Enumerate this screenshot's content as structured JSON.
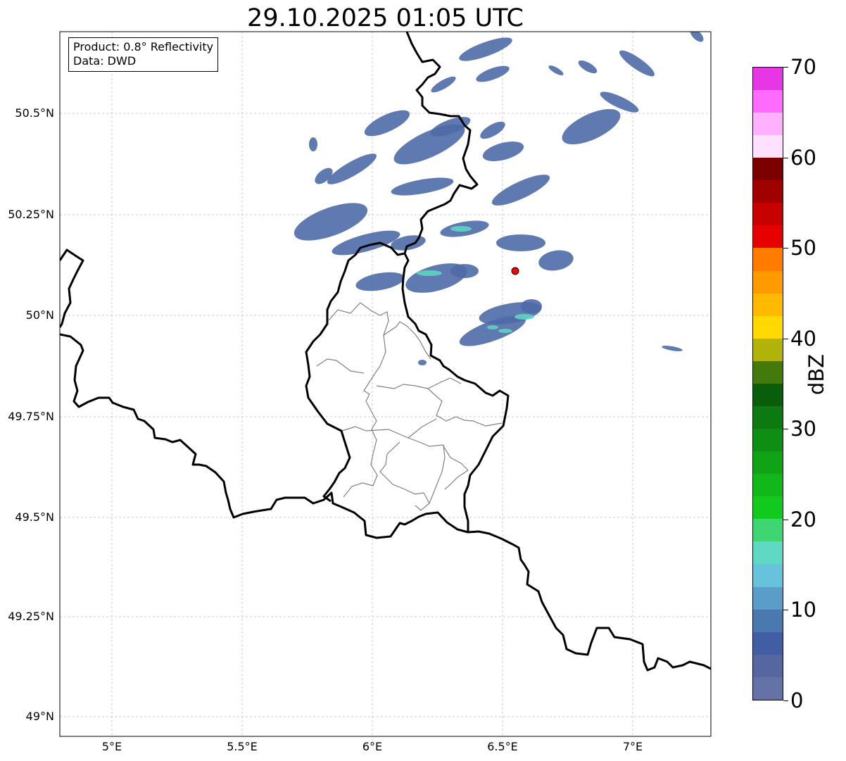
{
  "title": "29.10.2025 01:05 UTC",
  "info": {
    "product": "Product: 0.8° Reflectivity",
    "data": "Data: DWD"
  },
  "axes": {
    "lat_ticks": [
      "50.5°N",
      "50.25°N",
      "50°N",
      "49.75°N",
      "49.5°N",
      "49.25°N",
      "49°N"
    ],
    "lon_ticks": [
      "5°E",
      "5.5°E",
      "6°E",
      "6.5°E",
      "7°E"
    ],
    "lat_range": [
      48.95,
      50.7
    ],
    "lon_range": [
      4.8,
      7.3
    ],
    "grid": true
  },
  "colorbar": {
    "label": "dBZ",
    "ticks": [
      "0",
      "10",
      "20",
      "30",
      "40",
      "50",
      "60",
      "70"
    ],
    "min": 0,
    "max": 70,
    "colors": [
      "#6472a8",
      "#5566a0",
      "#415ea4",
      "#4a79b0",
      "#5a9dc8",
      "#67c3dc",
      "#5fd9c3",
      "#3dd672",
      "#12c91d",
      "#12b81a",
      "#10a315",
      "#0e8e13",
      "#0c7a10",
      "#095e0c",
      "#447a0c",
      "#b1b30a",
      "#ffd900",
      "#ffb900",
      "#ff9a00",
      "#ff7c00",
      "#e60000",
      "#c70000",
      "#a00000",
      "#7c0000",
      "#ffe0ff",
      "#ffb0ff",
      "#ff6aff",
      "#e636e6"
    ]
  },
  "marker": {
    "lon": 6.55,
    "lat": 50.11,
    "color": "#ff0000"
  }
}
